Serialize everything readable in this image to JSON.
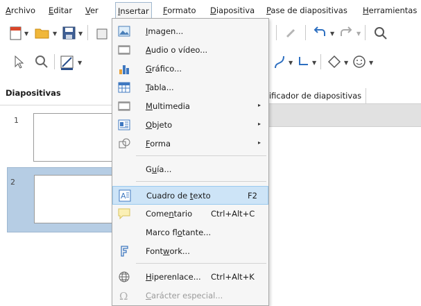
{
  "menubar": {
    "items": [
      {
        "pre": "",
        "u": "A",
        "post": "rchivo"
      },
      {
        "pre": "",
        "u": "E",
        "post": "ditar"
      },
      {
        "pre": "",
        "u": "V",
        "post": "er"
      },
      {
        "pre": "",
        "u": "I",
        "post": "nsertar"
      },
      {
        "pre": "",
        "u": "F",
        "post": "ormato"
      },
      {
        "pre": "",
        "u": "D",
        "post": "iapositiva"
      },
      {
        "pre": "",
        "u": "P",
        "post": "ase de diapositivas"
      },
      {
        "pre": "",
        "u": "H",
        "post": "erramientas"
      }
    ]
  },
  "slides_pane": {
    "title": "Diapositivas",
    "slides": [
      {
        "number": "1"
      },
      {
        "number": "2"
      }
    ]
  },
  "main": {
    "tab_label": "sificador de diapositivas"
  },
  "insert_menu": {
    "items": [
      {
        "pre": "",
        "u": "I",
        "post": "magen...",
        "shortcut": "",
        "submenu": false,
        "icon": "image-icon"
      },
      {
        "pre": "",
        "u": "A",
        "post": "udio o vídeo...",
        "shortcut": "",
        "submenu": false,
        "icon": "media-icon"
      },
      {
        "pre": "",
        "u": "G",
        "post": "ráfico...",
        "shortcut": "",
        "submenu": false,
        "icon": "chart-icon"
      },
      {
        "pre": "",
        "u": "T",
        "post": "abla...",
        "shortcut": "",
        "submenu": false,
        "icon": "table-icon"
      },
      {
        "pre": "",
        "u": "M",
        "post": "ultimedia",
        "shortcut": "",
        "submenu": true,
        "icon": "multimedia-icon"
      },
      {
        "pre": "",
        "u": "O",
        "post": "bjeto",
        "shortcut": "",
        "submenu": true,
        "icon": "object-icon"
      },
      {
        "pre": "",
        "u": "F",
        "post": "orma",
        "shortcut": "",
        "submenu": true,
        "icon": "shape-icon"
      },
      {
        "pre": "G",
        "u": "u",
        "post": "ía...",
        "shortcut": "",
        "submenu": false,
        "icon": ""
      },
      {
        "pre": "Cuadro de ",
        "u": "t",
        "post": "exto",
        "shortcut": "F2",
        "submenu": false,
        "icon": "text-box-icon",
        "highlighted": true
      },
      {
        "pre": "Come",
        "u": "n",
        "post": "tario",
        "shortcut": "Ctrl+Alt+C",
        "submenu": false,
        "icon": "comment-icon"
      },
      {
        "pre": "Marco fl",
        "u": "o",
        "post": "tante...",
        "shortcut": "",
        "submenu": false,
        "icon": ""
      },
      {
        "pre": "Font",
        "u": "w",
        "post": "ork...",
        "shortcut": "",
        "submenu": false,
        "icon": "fontwork-icon"
      },
      {
        "pre": "",
        "u": "H",
        "post": "iperenlace...",
        "shortcut": "Ctrl+Alt+K",
        "submenu": false,
        "icon": "hyperlink-icon"
      },
      {
        "pre": "",
        "u": "C",
        "post": "arácter especial...",
        "shortcut": "",
        "submenu": false,
        "icon": "special-character-icon",
        "disabled": true
      }
    ]
  },
  "colors": {
    "highlight_bg": "#cde4f7",
    "highlight_border": "#99c9ef",
    "selected_slide_bg": "#b6cde4",
    "menu_bg": "#f6f6f6"
  }
}
